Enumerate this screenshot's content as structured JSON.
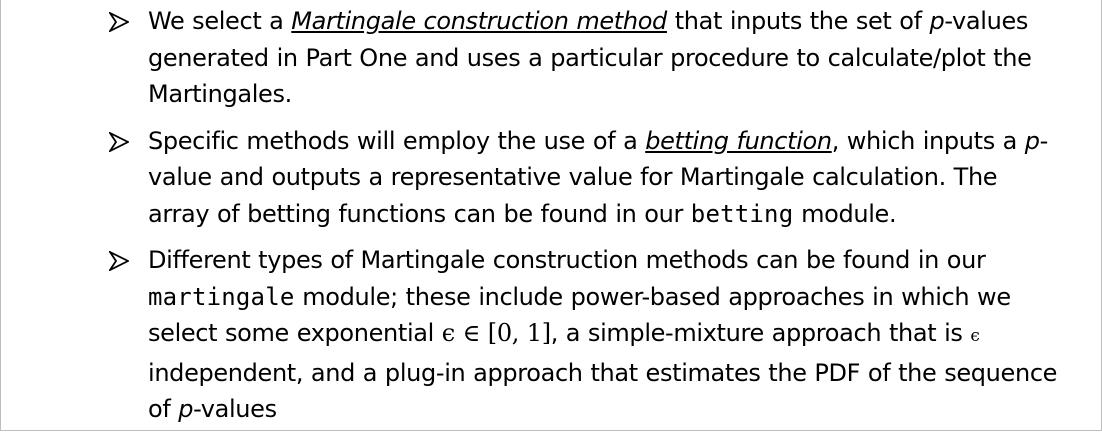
{
  "icons": {
    "bullet": "arrowhead-bullet-icon"
  },
  "bullets": [
    {
      "t1": "We select a ",
      "t2": "Martingale construction method",
      "t3": " that inputs the set of ",
      "t4": "p",
      "t5": "-values generated in Part One and uses a particular procedure to calculate/plot the Martingales."
    },
    {
      "t1": "Specific methods will employ the use of a ",
      "t2": "betting function",
      "t3": ", which inputs a ",
      "t4": "p",
      "t5": "-value and outputs a representative value for Martingale calculation. The array of betting functions can be found in our ",
      "t6": "betting",
      "t7": " module."
    },
    {
      "t1": "Different types of Martingale construction methods can be found in our ",
      "t2": "martingale",
      "t3": " module; these include power-based approaches in which we select some exponential ",
      "m1": "ϵ ∈ [0, 1]",
      "t4": ", a simple-mixture approach that is ",
      "m2": "ϵ",
      "t5": " independent, and a plug-in approach that estimates the PDF of the sequence of ",
      "t6": "p",
      "t7": "-values"
    }
  ]
}
